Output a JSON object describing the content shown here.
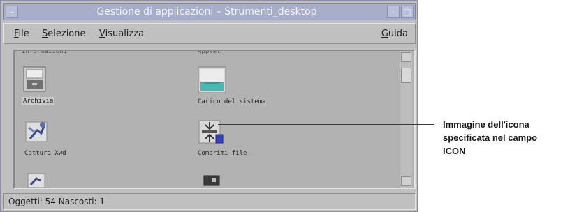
{
  "window": {
    "title": "Gestione di applicazioni – Strumenti_desktop",
    "menu_button": "–",
    "min_button": "·",
    "max_button": "□"
  },
  "menubar": {
    "file": "File",
    "selezione": "Selezione",
    "visualizza": "Visualizza",
    "guida": "Guida"
  },
  "pane": {
    "top_cut_labels": [
      "Informazioni",
      "Applet"
    ],
    "icons": [
      {
        "label": "Archivia",
        "icon": "archive-icon"
      },
      {
        "label": "Carico del sistema",
        "icon": "system-load-icon"
      },
      {
        "label": "Cattura Xwd",
        "icon": "capture-icon"
      },
      {
        "label": "Comprimi file",
        "icon": "compress-icon"
      }
    ]
  },
  "status": {
    "text": "Oggetti: 54 Nascosti: 1"
  },
  "callout": {
    "line1": "Immagine dell'icona",
    "line2": "specificata nel campo",
    "line3": "ICON"
  }
}
